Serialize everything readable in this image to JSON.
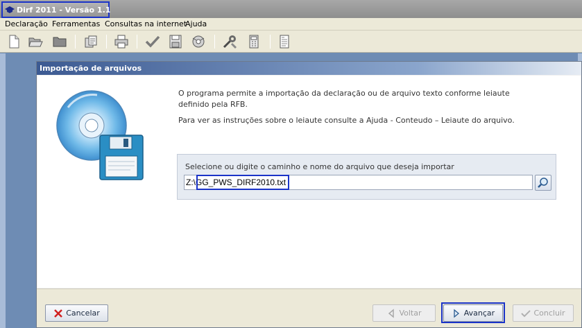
{
  "window": {
    "title": "Dirf 2011 - Versão 1.1"
  },
  "menu": {
    "items": [
      "Declaração",
      "Ferramentas",
      "Consultas na internet",
      "Ajuda"
    ]
  },
  "toolbar": {
    "icons": [
      "new-document-icon",
      "open-folder-icon",
      "folder-icon",
      "copy-icon",
      "print-icon",
      "check-icon",
      "save-icon",
      "transmit-icon",
      "tools-icon",
      "calculator-icon",
      "report-icon"
    ]
  },
  "dialog": {
    "title": "Importação de arquivos",
    "info_text_1": "O programa permite a importação da declaração ou de arquivo texto conforme leiaute definido pela RFB.",
    "info_text_2": "Para ver as instruções sobre o leiaute consulte a Ajuda - Conteudo – Leiaute do arquivo.",
    "file_label": "Selecione ou digite o caminho e nome do arquivo que deseja importar",
    "file_path": "Z:\\GG_PWS_DIRF2010.txt",
    "buttons": {
      "cancel": "Cancelar",
      "back": "Voltar",
      "next": "Avançar",
      "finish": "Concluir"
    }
  },
  "colors": {
    "highlight": "#1a33c8",
    "dialog_title_start": "#3c5a92",
    "desktop": "#6e8cb4"
  }
}
